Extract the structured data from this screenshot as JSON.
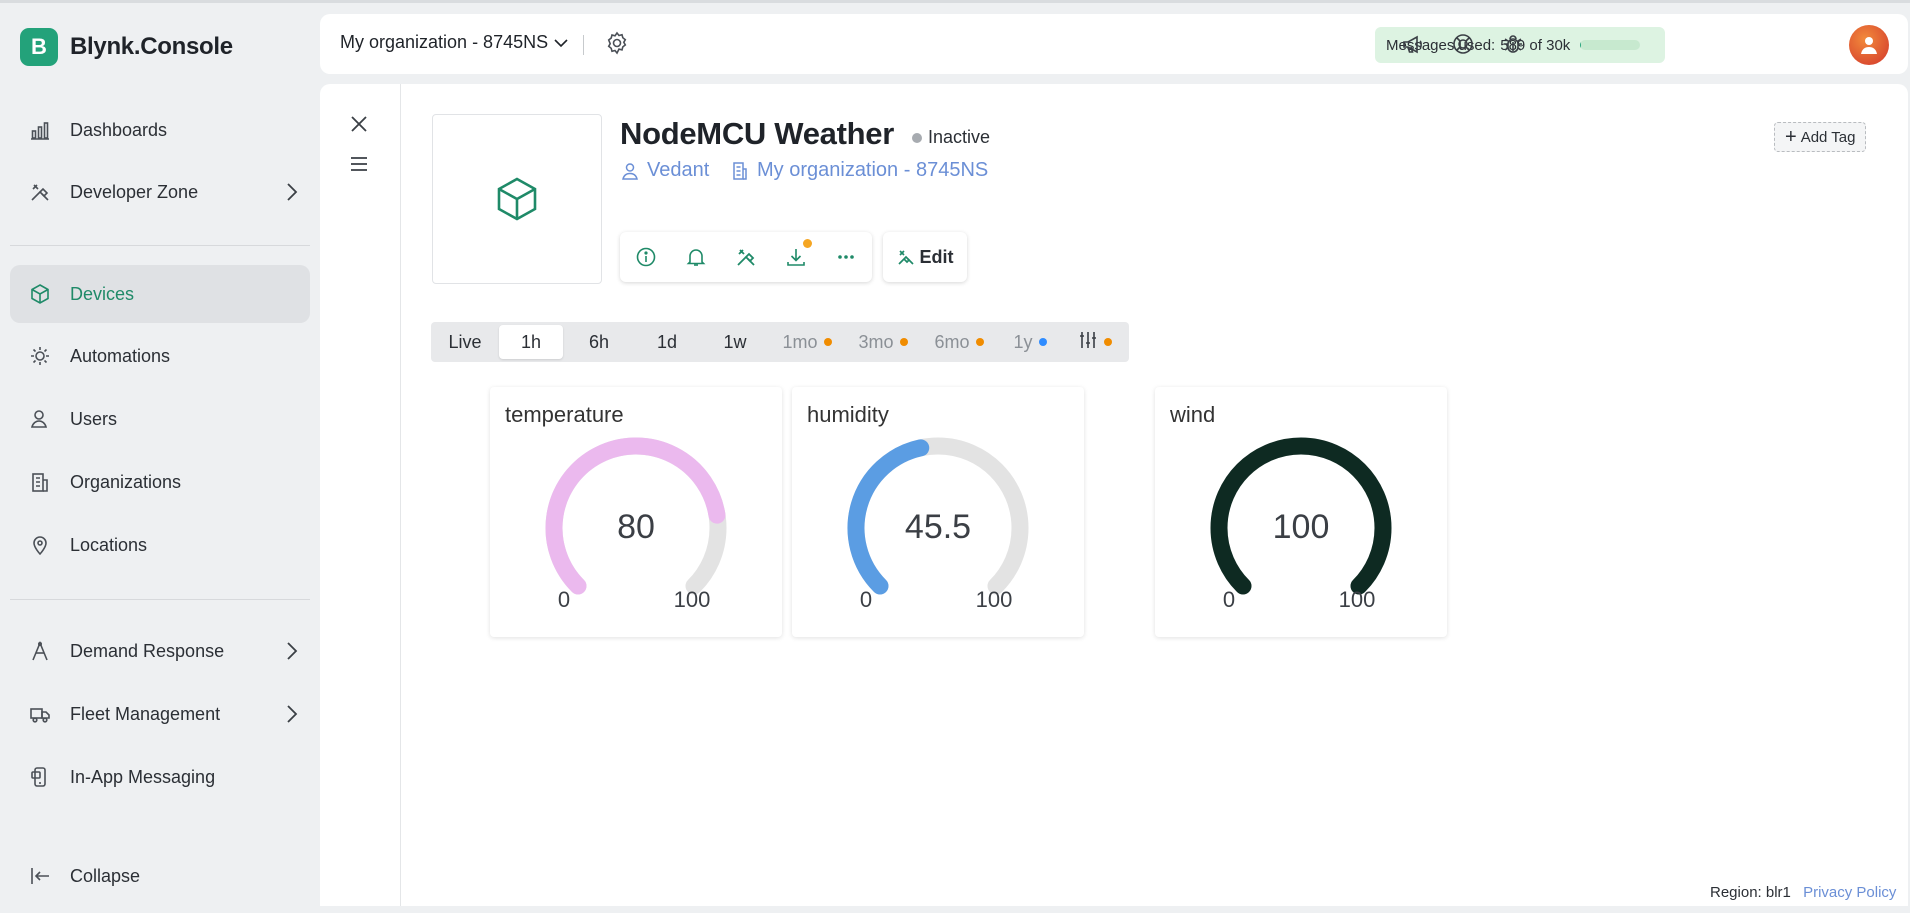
{
  "brand": {
    "logo_letter": "B",
    "name": "Blynk.Console",
    "color": "#23a27a"
  },
  "sidebar": {
    "items": [
      {
        "label": "Dashboards",
        "icon": "chart-bars-icon",
        "active": false,
        "has_children": false
      },
      {
        "label": "Developer Zone",
        "icon": "tools-icon",
        "active": false,
        "has_children": true
      },
      {
        "label": "Devices",
        "icon": "cube-icon",
        "active": true,
        "has_children": false
      },
      {
        "label": "Automations",
        "icon": "sun-gear-icon",
        "active": false,
        "has_children": false
      },
      {
        "label": "Users",
        "icon": "user-icon",
        "active": false,
        "has_children": false
      },
      {
        "label": "Organizations",
        "icon": "building-icon",
        "active": false,
        "has_children": false
      },
      {
        "label": "Locations",
        "icon": "map-pin-icon",
        "active": false,
        "has_children": false
      },
      {
        "label": "Demand Response",
        "icon": "compass-icon",
        "active": false,
        "has_children": true
      },
      {
        "label": "Fleet Management",
        "icon": "truck-icon",
        "active": false,
        "has_children": true
      },
      {
        "label": "In-App Messaging",
        "icon": "phone-message-icon",
        "active": false,
        "has_children": false
      }
    ],
    "collapse_label": "Collapse"
  },
  "topbar": {
    "org_name": "My organization - 8745NS",
    "messages": {
      "prefix": "Messages used:",
      "count": "589 of 30k",
      "fraction": 0.02
    },
    "icons": [
      "megaphone-icon",
      "lifebuoy-icon",
      "bug-icon"
    ]
  },
  "device": {
    "name": "NodeMCU Weather",
    "status": "Inactive",
    "owner": "Vedant",
    "organization": "My organization - 8745NS",
    "add_tag_label": "Add Tag",
    "edit_label": "Edit",
    "actions": [
      "info-icon",
      "bell-icon",
      "tools-icon",
      "download-icon",
      "more-icon"
    ]
  },
  "time_ranges": [
    {
      "label": "Live",
      "state": "normal",
      "dot": null
    },
    {
      "label": "1h",
      "state": "active",
      "dot": null
    },
    {
      "label": "6h",
      "state": "normal",
      "dot": null
    },
    {
      "label": "1d",
      "state": "normal",
      "dot": null
    },
    {
      "label": "1w",
      "state": "normal",
      "dot": null
    },
    {
      "label": "1mo",
      "state": "disabled",
      "dot": "#f08c00"
    },
    {
      "label": "3mo",
      "state": "disabled",
      "dot": "#f08c00"
    },
    {
      "label": "6mo",
      "state": "disabled",
      "dot": "#f08c00"
    },
    {
      "label": "1y",
      "state": "disabled",
      "dot": "#2f8cff"
    },
    {
      "label": "",
      "state": "disabled",
      "dot": "#f08c00",
      "icon": "sliders-icon"
    }
  ],
  "gauges": [
    {
      "title": "temperature",
      "value": 80,
      "display": "80",
      "min": 0,
      "max": 100,
      "color": "#ebb9ee",
      "track": "#e3e3e3"
    },
    {
      "title": "humidity",
      "value": 45.5,
      "display": "45.5",
      "min": 0,
      "max": 100,
      "color": "#5b9de3",
      "track": "#e3e3e3"
    },
    {
      "title": "wind",
      "value": 100,
      "display": "100",
      "min": 0,
      "max": 100,
      "color": "#0e2a22",
      "track": "#e3e3e3"
    }
  ],
  "footer": {
    "region": "Region: blr1",
    "privacy": "Privacy Policy"
  }
}
